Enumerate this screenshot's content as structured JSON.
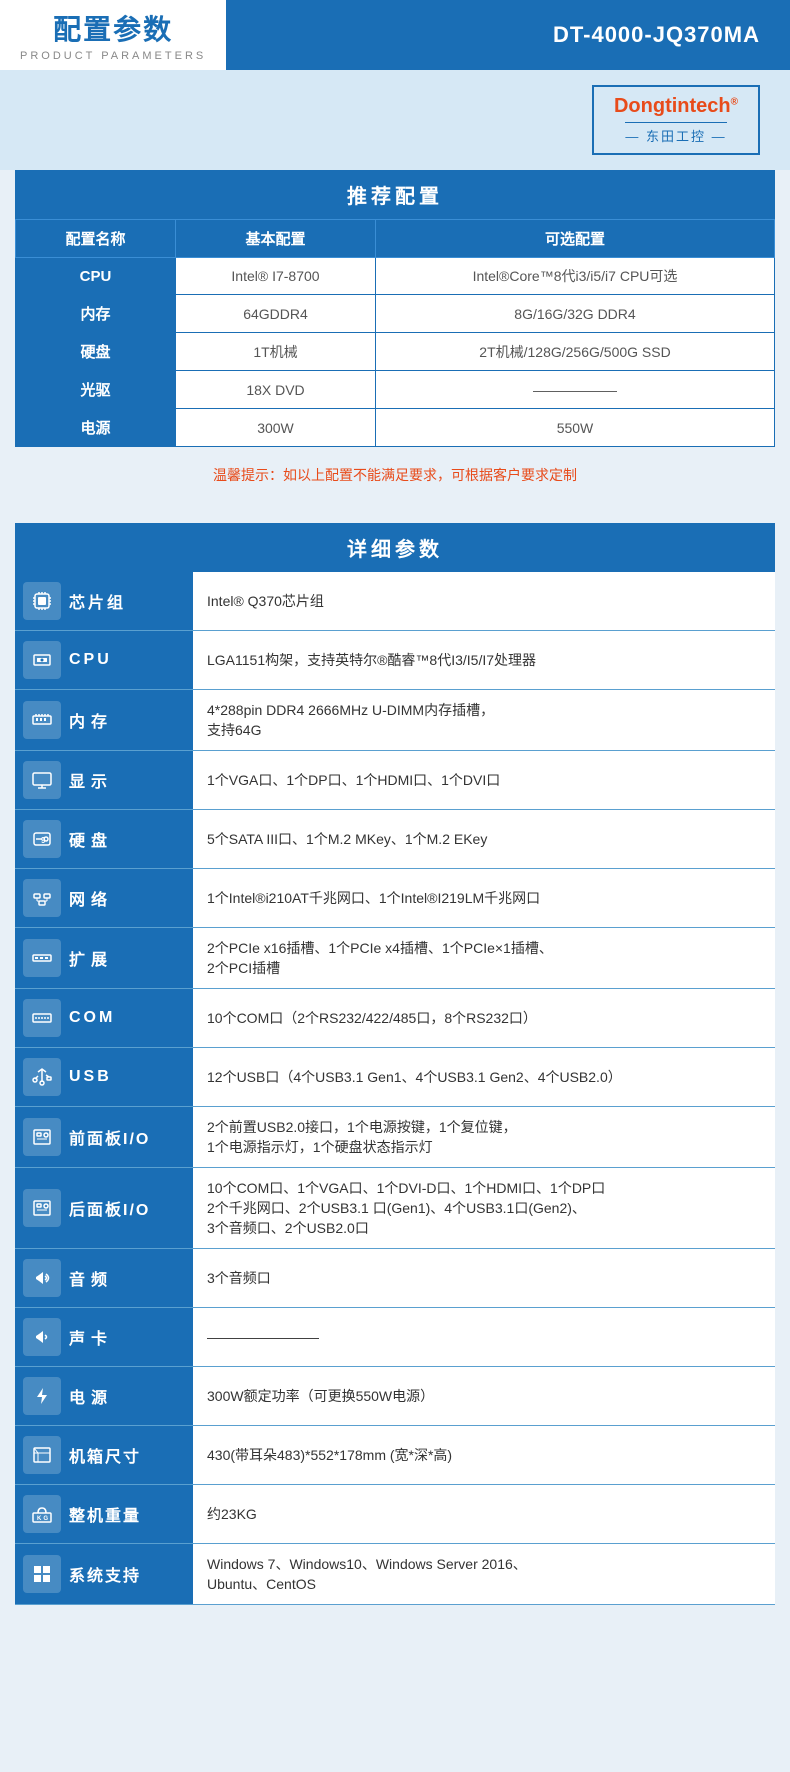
{
  "header": {
    "title_zh": "配置参数",
    "title_en": "PRODUCT PARAMETERS",
    "model": "DT-4000-JQ370MA"
  },
  "logo": {
    "brand": "Dongtintech",
    "registered": "®",
    "sub": "— 东田工控 —"
  },
  "recommended": {
    "section_title": "推荐配置",
    "columns": [
      "配置名称",
      "基本配置",
      "可选配置"
    ],
    "rows": [
      {
        "name": "CPU",
        "basic": "Intel® I7-8700",
        "optional": "Intel®Core™8代i3/i5/i7 CPU可选"
      },
      {
        "name": "内存",
        "basic": "64GDDR4",
        "optional": "8G/16G/32G DDR4"
      },
      {
        "name": "硬盘",
        "basic": "1T机械",
        "optional": "2T机械/128G/256G/500G SSD"
      },
      {
        "name": "光驱",
        "basic": "18X DVD",
        "optional": "——————"
      },
      {
        "name": "电源",
        "basic": "300W",
        "optional": "550W"
      }
    ],
    "warning": "温馨提示：如以上配置不能满足要求，可根据客户要求定制"
  },
  "detail": {
    "section_title": "详细参数",
    "rows": [
      {
        "icon": "⚙",
        "label": "芯片组",
        "value": "Intel® Q370芯片组"
      },
      {
        "icon": "🖥",
        "label": "CPU",
        "value": "LGA1151构架，支持英特尔®酷睿™8代I3/I5/I7处理器"
      },
      {
        "icon": "▦",
        "label": "内存",
        "value": "4*288pin DDR4 2666MHz U-DIMM内存插槽，\n支持64G"
      },
      {
        "icon": "▤",
        "label": "显示",
        "value": "1个VGA口、1个DP口、1个HDMI口、1个DVI口"
      },
      {
        "icon": "⬡",
        "label": "硬盘",
        "value": "5个SATA III口、1个M.2 MKey、1个M.2 EKey"
      },
      {
        "icon": "🌐",
        "label": "网络",
        "value": "1个Intel®i210AT千兆网口、1个Intel®I219LM千兆网口"
      },
      {
        "icon": "▣",
        "label": "扩展",
        "value": "2个PCIe x16插槽、1个PCIe x4插槽、1个PCIe×1插槽、\n2个PCI插槽"
      },
      {
        "icon": "▤",
        "label": "COM",
        "value": "10个COM口（2个RS232/422/485口，8个RS232口）"
      },
      {
        "icon": "⬡",
        "label": "USB",
        "value": "12个USB口（4个USB3.1 Gen1、4个USB3.1 Gen2、4个USB2.0）"
      },
      {
        "icon": "📋",
        "label": "前面板I/O",
        "value": "2个前置USB2.0接口，1个电源按键，1个复位键，\n1个电源指示灯，1个硬盘状态指示灯"
      },
      {
        "icon": "📋",
        "label": "后面板I/O",
        "value": "10个COM口、1个VGA口、1个DVI-D口、1个HDMI口、1个DP口\n2个千兆网口、2个USB3.1 口(Gen1)、4个USB3.1口(Gen2)、\n3个音频口、2个USB2.0口"
      },
      {
        "icon": "🔊",
        "label": "音频",
        "value": "3个音频口"
      },
      {
        "icon": "🔊",
        "label": "声卡",
        "value": "————————"
      },
      {
        "icon": "⚡",
        "label": "电源",
        "value": "300W额定功率（可更换550W电源）"
      },
      {
        "icon": "✕",
        "label": "机箱尺寸",
        "value": "430(带耳朵483)*552*178mm (宽*深*高)"
      },
      {
        "icon": "⚖",
        "label": "整机重量",
        "value": "约23KG"
      },
      {
        "icon": "⊞",
        "label": "系统支持",
        "value": "Windows 7、Windows10、Windows Server 2016、\nUbuntu、CentOS"
      }
    ]
  }
}
